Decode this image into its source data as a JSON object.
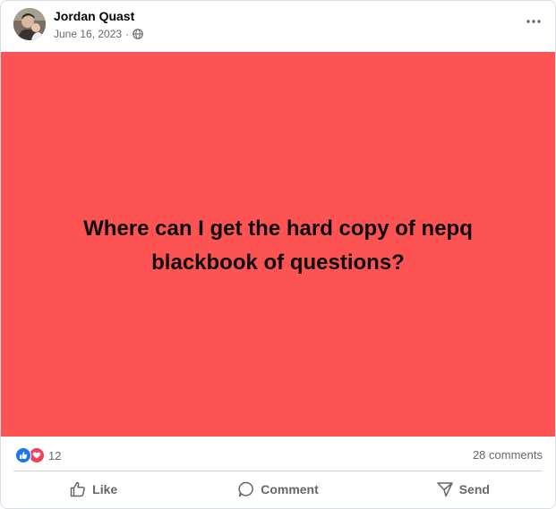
{
  "post": {
    "author": "Jordan Quast",
    "date": "June 16, 2023",
    "separator": "·",
    "content_text": "Where can I get the hard copy of nepq blackbook of questions?",
    "background_color": "#fe5353"
  },
  "stats": {
    "reaction_count": "12",
    "comments_label": "28 comments"
  },
  "actions": {
    "like": "Like",
    "comment": "Comment",
    "send": "Send"
  },
  "icons": {
    "more": "more-horizontal-icon",
    "privacy": "globe-icon",
    "like_reaction": "thumbs-up-icon",
    "love_reaction": "heart-icon"
  }
}
